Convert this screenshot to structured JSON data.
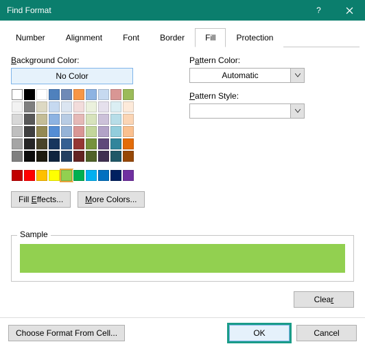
{
  "title": "Find Format",
  "tabs": [
    "Number",
    "Alignment",
    "Font",
    "Border",
    "Fill",
    "Protection"
  ],
  "active_tab": "Fill",
  "labels": {
    "bg": "Background Color:",
    "nocolor": "No Color",
    "fill_effects": "Fill Effects...",
    "more_colors": "More Colors...",
    "pattern_color": "Pattern Color:",
    "pattern_style": "Pattern Style:",
    "automatic": "Automatic",
    "sample": "Sample",
    "clear": "Clear",
    "choose": "Choose Format From Cell...",
    "ok": "OK",
    "cancel": "Cancel"
  },
  "sample_color": "#92d050",
  "palette_main": [
    [
      "nc",
      "#000000",
      "#FFFFFF",
      "#4F81BD",
      "#6F8AB7",
      "#F79646",
      "#8DB3E2",
      "#C6D9F0",
      "#D99694",
      "#9BBB59"
    ],
    [
      "#F2F2F2",
      "#7F7F7F",
      "#DDD9C3",
      "#C6D9F0",
      "#DBE5F1",
      "#F2DCDB",
      "#EBF1DD",
      "#E5E0EC",
      "#DBEEF3",
      "#FDEADA"
    ],
    [
      "#D8D8D8",
      "#595959",
      "#C4BD97",
      "#8DB3E2",
      "#B8CCE4",
      "#E5B9B7",
      "#D7E3BC",
      "#CCC1D9",
      "#B7DDE8",
      "#FBD5B5"
    ],
    [
      "#BFBFBF",
      "#3F3F3F",
      "#938953",
      "#548DD4",
      "#95B3D7",
      "#D99694",
      "#C3D69B",
      "#B2A2C7",
      "#92CDDC",
      "#FAC08F"
    ],
    [
      "#A5A5A5",
      "#262626",
      "#494429",
      "#17365D",
      "#366092",
      "#953734",
      "#76923C",
      "#5F497A",
      "#31859B",
      "#E36C09"
    ],
    [
      "#7F7F7F",
      "#0C0C0C",
      "#1D1B10",
      "#0F243E",
      "#244061",
      "#632423",
      "#4F6128",
      "#3F3151",
      "#205867",
      "#974806"
    ]
  ],
  "palette_standard": [
    "#C00000",
    "#FF0000",
    "#FFC000",
    "#FFFF00",
    "#92D050",
    "#00B050",
    "#00B0F0",
    "#0070C0",
    "#002060",
    "#7030A0"
  ],
  "selected_swatch": "#92D050"
}
